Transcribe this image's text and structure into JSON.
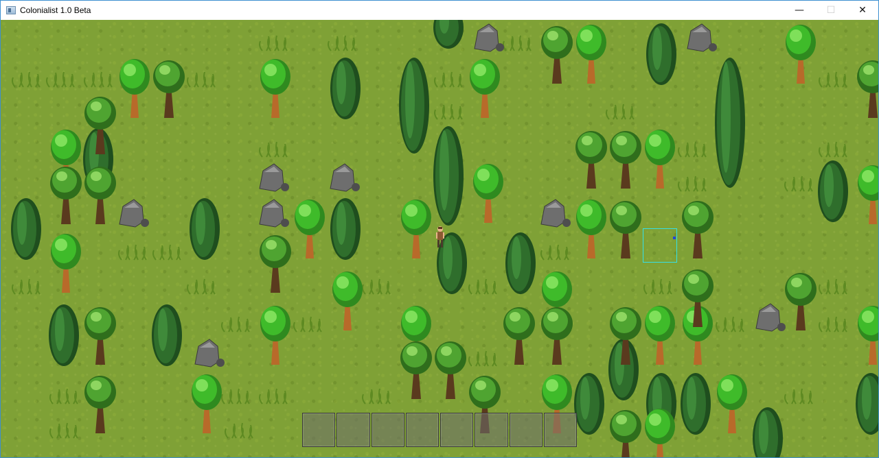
{
  "window": {
    "title": "Colonialist 1.0 Beta",
    "controls": {
      "minimize": "—",
      "maximize": "☐",
      "close": "✕"
    }
  },
  "game": {
    "terrain": "grass",
    "hotbar": {
      "slot_count": 8
    },
    "colors": {
      "grass": "#7fa136",
      "tree_leaf": "#3fbb2a",
      "tree_trunk": "#b86a2a",
      "pine": "#2f6e2c",
      "rock": "#6e6e6e",
      "cursor": "#35e1e8"
    }
  }
}
